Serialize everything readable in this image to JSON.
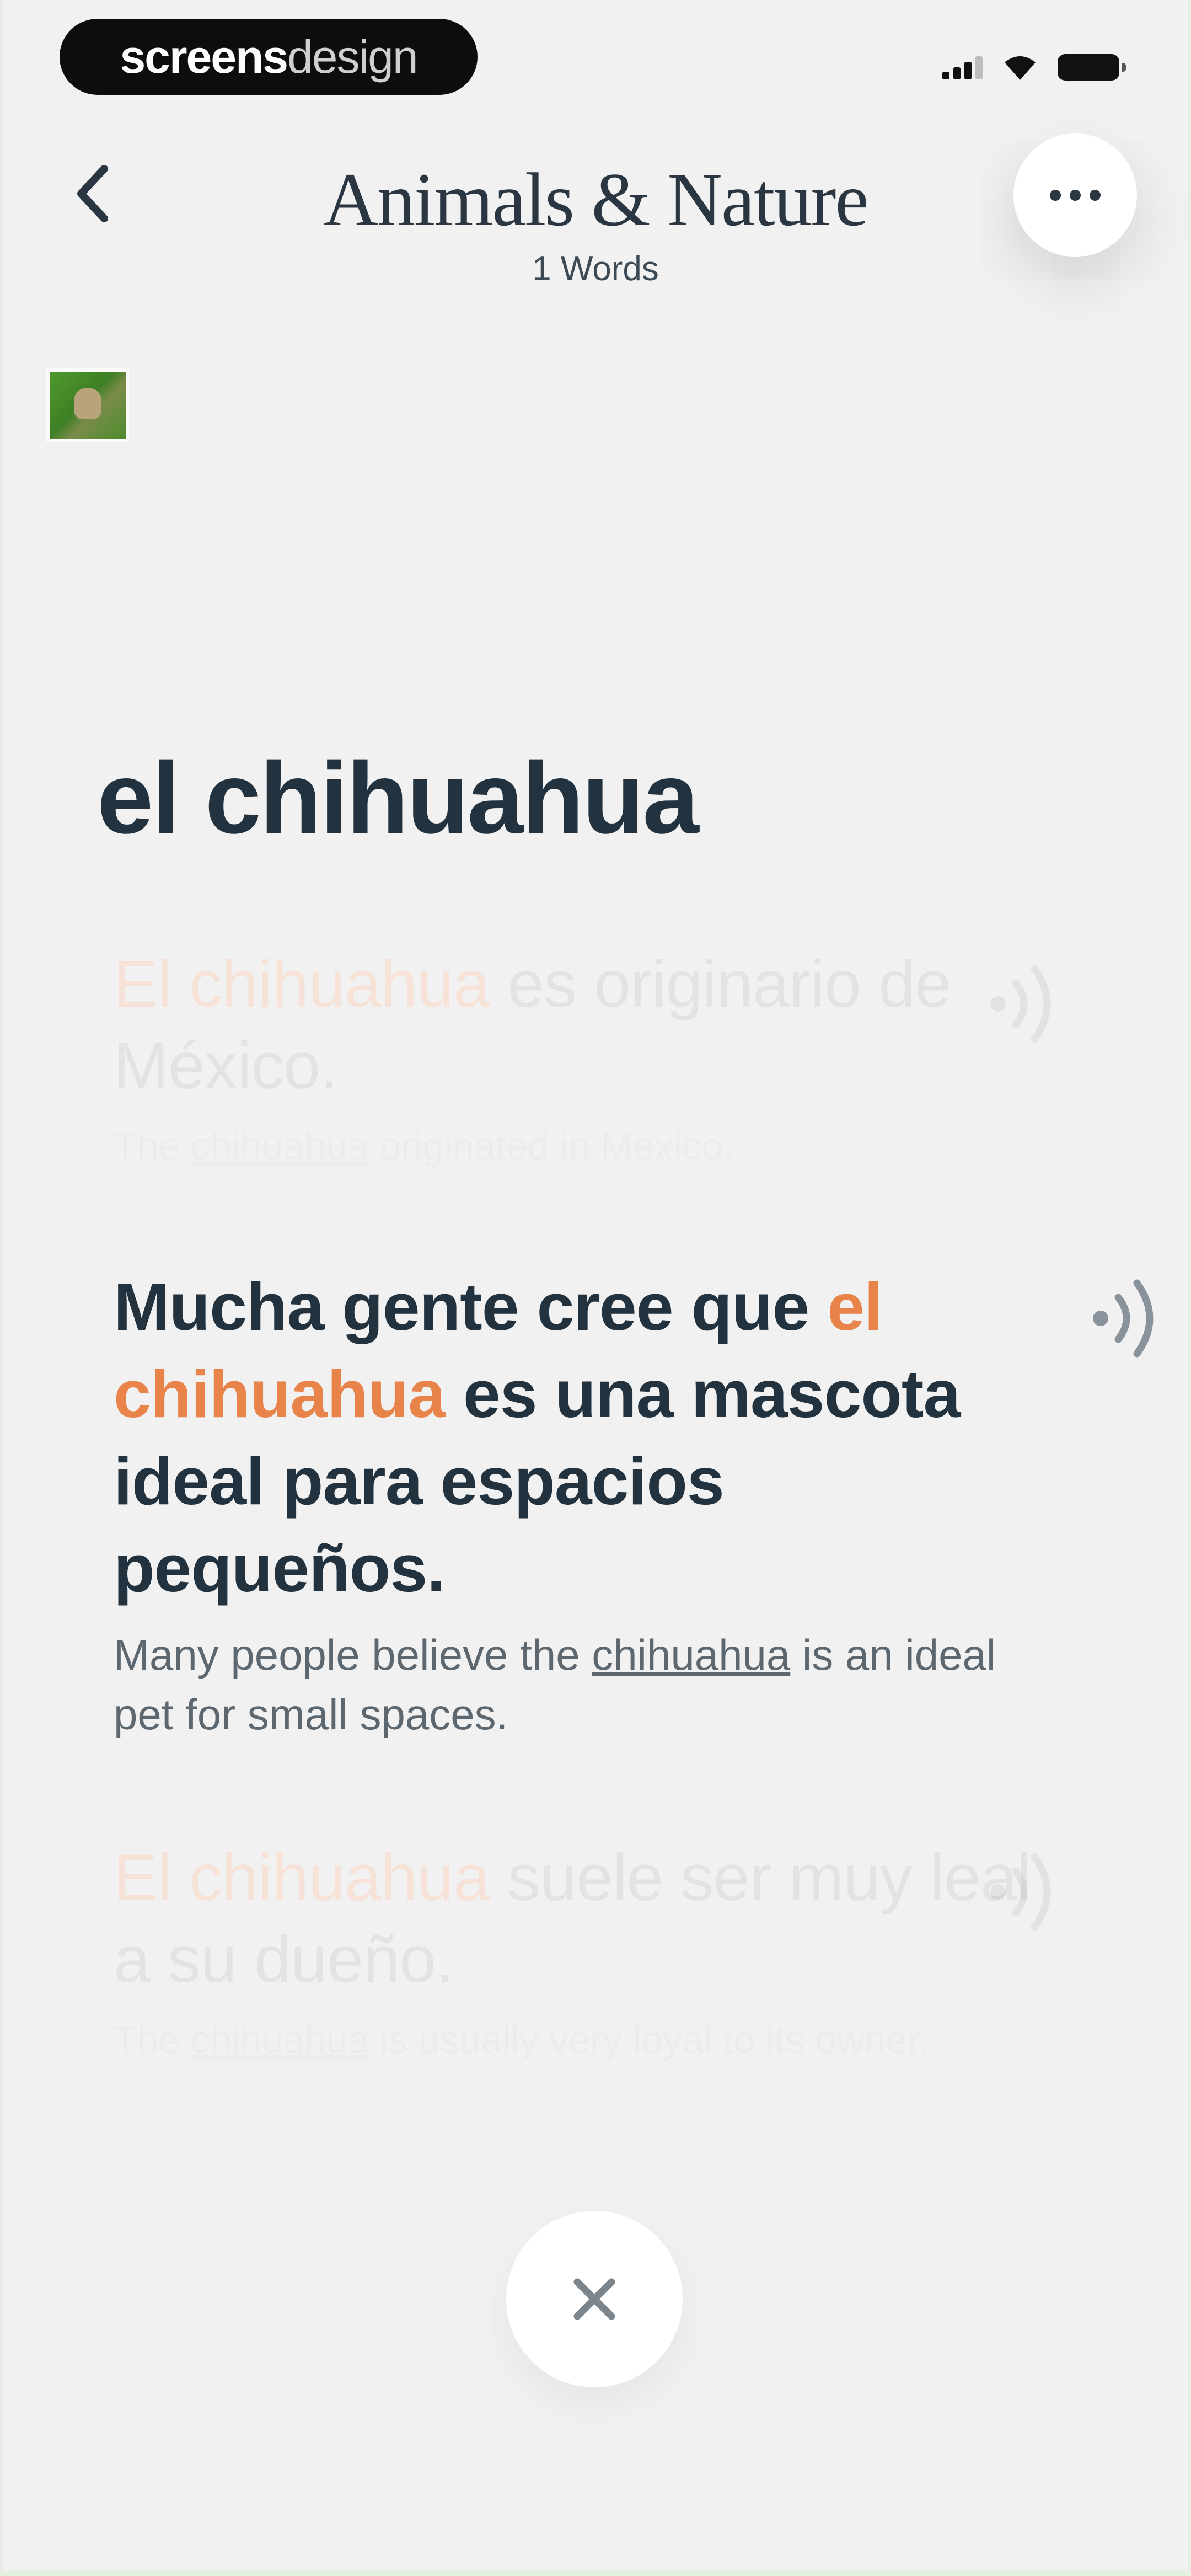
{
  "status_bar": {
    "brand_bold": "screens",
    "brand_light": "design",
    "icons": [
      "signal-icon",
      "wifi-icon",
      "battery-icon"
    ]
  },
  "header": {
    "back_icon": "chevron-left-icon",
    "title": "Animals & Nature",
    "subtitle": "1 Words",
    "more_icon": "more-horizontal-icon"
  },
  "word": {
    "term": "el chihuahua",
    "thumbnail": "dog-photo-thumbnail"
  },
  "examples": [
    {
      "es_highlight": "El chihuahua",
      "es_rest": " es originario de México.",
      "en_before": "The ",
      "en_term": "chihuahua",
      "en_after": " originated in Mexico.",
      "state": "faded"
    },
    {
      "es_before": "Mucha gente cree que ",
      "es_highlight": "el chihuahua",
      "es_rest": " es una mascota ideal para espacios pequeños.",
      "en_before": "Many people believe the ",
      "en_term": "chihuahua",
      "en_after": " is an ideal pet for small spaces.",
      "state": "active"
    },
    {
      "es_highlight": "El chihuahua",
      "es_rest": " suele ser muy leal a su dueño.",
      "en_before": "The ",
      "en_term": "chihuahua",
      "en_after": " is usually very loyal to its owner.",
      "state": "faded"
    }
  ],
  "audio_icon": "speaker-waves-icon",
  "close_icon": "close-icon",
  "colors": {
    "background": "#f1f1f1",
    "text_dark": "#22333f",
    "highlight": "#e8834a",
    "secondary_text": "#5d6770"
  }
}
